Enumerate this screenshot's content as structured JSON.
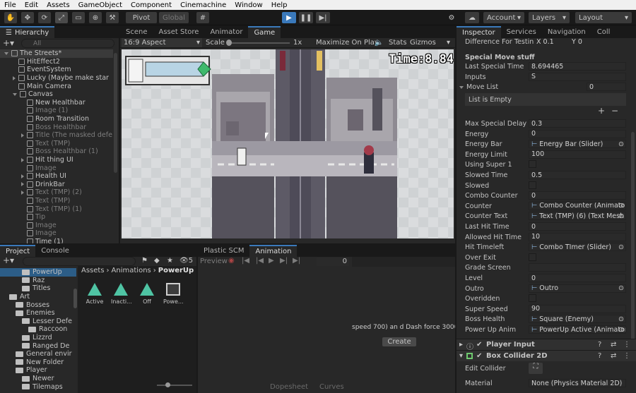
{
  "menu": [
    "File",
    "Edit",
    "Assets",
    "GameObject",
    "Component",
    "Cinemachine",
    "Window",
    "Help"
  ],
  "toolbar": {
    "pivot": "Pivot",
    "global": "Global",
    "account": "Account",
    "layers": "Layers",
    "layout": "Layout"
  },
  "hierarchy": {
    "tab": "Hierarchy",
    "search_placeholder": "All",
    "items": [
      {
        "label": "The Streets*",
        "indent": 0,
        "dim": false
      },
      {
        "label": "HitEffect2",
        "indent": 1,
        "dim": false
      },
      {
        "label": "EventSystem",
        "indent": 1,
        "dim": false
      },
      {
        "label": "Lucky (Maybe make star",
        "indent": 1,
        "dim": false
      },
      {
        "label": "Main Camera",
        "indent": 1,
        "dim": false
      },
      {
        "label": "Canvas",
        "indent": 1,
        "dim": false
      },
      {
        "label": "New Healthbar",
        "indent": 2,
        "dim": false
      },
      {
        "label": "Image (1)",
        "indent": 2,
        "dim": true
      },
      {
        "label": "Room Transition",
        "indent": 2,
        "dim": false
      },
      {
        "label": "Boss Healthbar",
        "indent": 2,
        "dim": true
      },
      {
        "label": "Title (The masked defe",
        "indent": 2,
        "dim": true
      },
      {
        "label": "Text (TMP)",
        "indent": 2,
        "dim": true
      },
      {
        "label": "Boss Healthbar (1)",
        "indent": 2,
        "dim": true
      },
      {
        "label": "Hit thing UI",
        "indent": 2,
        "dim": false
      },
      {
        "label": "Image",
        "indent": 2,
        "dim": true
      },
      {
        "label": "Health UI",
        "indent": 2,
        "dim": false
      },
      {
        "label": "DrinkBar",
        "indent": 2,
        "dim": false
      },
      {
        "label": "Text (TMP) (2)",
        "indent": 2,
        "dim": true
      },
      {
        "label": "Text (TMP)",
        "indent": 2,
        "dim": true
      },
      {
        "label": "Text (TMP) (1)",
        "indent": 2,
        "dim": true
      },
      {
        "label": "Tip",
        "indent": 2,
        "dim": true
      },
      {
        "label": "Image",
        "indent": 2,
        "dim": true
      },
      {
        "label": "Image",
        "indent": 2,
        "dim": true
      },
      {
        "label": "Time (1)",
        "indent": 2,
        "dim": false
      }
    ]
  },
  "scene_tabs": [
    "Scene",
    "Asset Store",
    "Animator",
    "Game"
  ],
  "game": {
    "aspect": "16:9 Aspect",
    "scale_label": "Scale",
    "scale_value": "1x",
    "maximize": "Maximize On Play",
    "stats": "Stats",
    "gizmos": "Gizmos",
    "timer": "Time:8.84"
  },
  "project": {
    "tabs": [
      "Project",
      "Console"
    ],
    "tree": [
      {
        "label": "PowerUp",
        "indent": 3
      },
      {
        "label": "Raz",
        "indent": 3
      },
      {
        "label": "Titles",
        "indent": 3
      },
      {
        "label": "Art",
        "indent": 1
      },
      {
        "label": "Bosses",
        "indent": 2
      },
      {
        "label": "Enemies",
        "indent": 2
      },
      {
        "label": "Lesser Defe",
        "indent": 3
      },
      {
        "label": "Raccoon",
        "indent": 4
      },
      {
        "label": "Lizzrd",
        "indent": 3
      },
      {
        "label": "Ranged De",
        "indent": 3
      },
      {
        "label": "General envir",
        "indent": 2
      },
      {
        "label": "New Folder",
        "indent": 2
      },
      {
        "label": "Player",
        "indent": 2
      },
      {
        "label": "Newer",
        "indent": 3
      },
      {
        "label": "Tilemaps",
        "indent": 3
      }
    ],
    "breadcrumb": [
      "Assets",
      "Animations",
      "PowerUp"
    ],
    "assets": [
      "Active",
      "Inacti...",
      "Off",
      "Powe..."
    ],
    "count": "5"
  },
  "animation": {
    "tabs": [
      "Plastic SCM",
      "Animation"
    ],
    "preview": "Preview",
    "frame": "0",
    "message": "speed 700) an d Dash force 3000",
    "create": "Create",
    "dopesheet": "Dopesheet",
    "curves": "Curves"
  },
  "inspector": {
    "tabs": [
      "Inspector",
      "Services",
      "Navigation",
      "Coll"
    ],
    "diff_label": "Difference For Testin",
    "diff_x": "X  0.1",
    "diff_y": "Y  0",
    "section": "Special Move stuff",
    "fields": [
      {
        "label": "Last Special Time",
        "value": "8.694465",
        "type": "text"
      },
      {
        "label": "Inputs",
        "value": "S",
        "type": "text"
      }
    ],
    "move_list": {
      "label": "Move List",
      "count": "0",
      "empty": "List is Empty"
    },
    "fields2": [
      {
        "label": "Max Special Delay",
        "value": "0.3",
        "type": "text"
      },
      {
        "label": "Energy",
        "value": "0",
        "type": "text"
      },
      {
        "label": "Energy Bar",
        "value": "Energy Bar (Slider)",
        "type": "obj"
      },
      {
        "label": "Energy Limit",
        "value": "100",
        "type": "text"
      },
      {
        "label": "Using Super 1",
        "value": "",
        "type": "check"
      },
      {
        "label": "Slowed Time",
        "value": "0.5",
        "type": "text"
      },
      {
        "label": "Slowed",
        "value": "",
        "type": "check"
      },
      {
        "label": "Combo Counter",
        "value": "0",
        "type": "text"
      },
      {
        "label": "Counter",
        "value": "Combo Counter (Animator)",
        "type": "obj"
      },
      {
        "label": "Counter Text",
        "value": "Text (TMP) (6) (Text Mesh P",
        "type": "obj"
      },
      {
        "label": "Last Hit Time",
        "value": "0",
        "type": "text"
      },
      {
        "label": "Allowed Hit Time",
        "value": "10",
        "type": "text"
      },
      {
        "label": "Hit Timeleft",
        "value": "Combo TImer (Slider)",
        "type": "obj"
      },
      {
        "label": "Over Exit",
        "value": "",
        "type": "check"
      },
      {
        "label": "Grade Screen",
        "value": "",
        "type": "text"
      },
      {
        "label": "Level",
        "value": "0",
        "type": "text"
      },
      {
        "label": "Outro",
        "value": "Outro",
        "type": "obj"
      },
      {
        "label": "Overidden",
        "value": "",
        "type": "check"
      },
      {
        "label": "Super Speed",
        "value": "90",
        "type": "text"
      },
      {
        "label": "Boss Health",
        "value": "Square (Enemy)",
        "type": "obj"
      },
      {
        "label": "Power Up Anim",
        "value": "PowerUp Active (Animator)",
        "type": "obj"
      }
    ],
    "components": [
      "Player Input",
      "Box Collider 2D"
    ],
    "edit_collider": "Edit Collider",
    "material_label": "Material",
    "material_value": "None (Physics Material 2D)"
  }
}
